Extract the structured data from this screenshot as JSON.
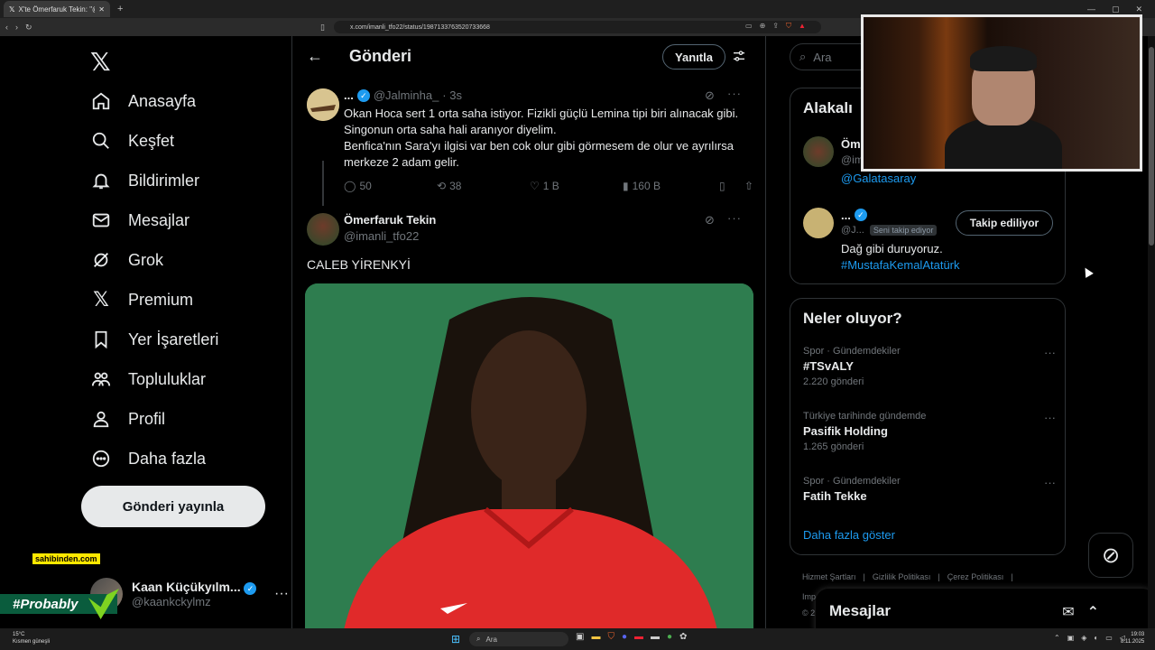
{
  "browser": {
    "tab_title": "X'te Ömerfaruk Tekin: \"@Jalmin",
    "new_tab": "+",
    "url": "x.com/imanli_tfo22/status/1987133763520733668"
  },
  "nav": {
    "items": [
      {
        "label": "Anasayfa"
      },
      {
        "label": "Keşfet"
      },
      {
        "label": "Bildirimler"
      },
      {
        "label": "Mesajlar"
      },
      {
        "label": "Grok"
      },
      {
        "label": "Premium"
      },
      {
        "label": "Yer İşaretleri"
      },
      {
        "label": "Topluluklar"
      },
      {
        "label": "Profil"
      },
      {
        "label": "Daha fazla"
      }
    ],
    "post_button": "Gönderi yayınla",
    "profile_name": "Kaan Küçükyılm...",
    "profile_handle": "@kaankckylmz",
    "profile_more": "···"
  },
  "overlay": {
    "sponsor": "sahibinden.com",
    "tag": "#Probably"
  },
  "header": {
    "title": "Gönderi",
    "reply_button": "Yanıtla"
  },
  "tweet1": {
    "name": "...",
    "handle": "@Jalminha_",
    "time": "· 3s",
    "body": "Okan Hoca sert 1 orta saha istiyor. Fizikli güçlü Lemina tipi biri alınacak gibi. Singonun orta saha hali aranıyor diyelim.\nBenfica'nın Sara'yı ilgisi var ben cok olur gibi görmesem de olur ve ayrılırsa merkeze 2 adam gelir.",
    "replies": "50",
    "reposts": "38",
    "likes": "1 B",
    "views": "160 B"
  },
  "tweet2": {
    "name": "Ömerfaruk Tekin",
    "handle": "@imanli_tfo22",
    "text": "CALEB YİRENKYİ"
  },
  "right": {
    "search_placeholder": "Ara",
    "related_title": "Alakalı",
    "rel1_name": "Öm",
    "rel1_handle": "@im",
    "rel1_link": "@Galatasaray",
    "rel2_name": "...",
    "rel2_handle": "@J...",
    "rel2_badge": "Seni takip ediyor",
    "rel2_button": "Takip ediliyor",
    "rel2_bio": "Dağ gibi duruyoruz.",
    "rel2_link": "#MustafaKemalAtatürk",
    "trends_title": "Neler oluyor?",
    "trends": [
      {
        "category": "Spor · Gündemdekiler",
        "name": "#TSvALY",
        "count": "2.220 gönderi"
      },
      {
        "category": "Türkiye tarihinde gündemde",
        "name": "Pasifik Holding",
        "count": "1.265 gönderi"
      },
      {
        "category": "Spor · Gündemdekiler",
        "name": "Fatih Tekke",
        "count": ""
      }
    ],
    "show_more": "Daha fazla göster",
    "footer": [
      "Hizmet Şartları",
      "|",
      "Gizlilik Politikası",
      "|",
      "Çerez Politikası",
      "|"
    ],
    "footer_imp": "Imp",
    "footer_c": "© 2",
    "messages": "Mesajlar"
  },
  "taskbar": {
    "weather_temp": "15°C",
    "weather_desc": "Kısmen güneşli",
    "search": "Ara",
    "time": "19:03",
    "date": "8.11.2025"
  }
}
